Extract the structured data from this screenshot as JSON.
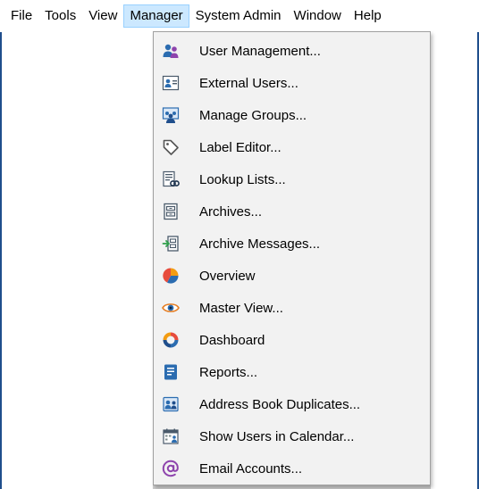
{
  "menubar": {
    "items": [
      {
        "label": "File"
      },
      {
        "label": "Tools"
      },
      {
        "label": "View"
      },
      {
        "label": "Manager"
      },
      {
        "label": "System Admin"
      },
      {
        "label": "Window"
      },
      {
        "label": "Help"
      }
    ],
    "active": "Manager"
  },
  "manager_menu": {
    "items": [
      {
        "label": "User Management...",
        "icon": "user-management-icon"
      },
      {
        "label": "External Users...",
        "icon": "external-users-icon"
      },
      {
        "label": "Manage Groups...",
        "icon": "manage-groups-icon"
      },
      {
        "label": "Label Editor...",
        "icon": "label-tag-icon"
      },
      {
        "label": "Lookup Lists...",
        "icon": "lookup-lists-icon"
      },
      {
        "label": "Archives...",
        "icon": "archives-icon"
      },
      {
        "label": "Archive Messages...",
        "icon": "archive-messages-icon"
      },
      {
        "label": "Overview",
        "icon": "pie-chart-icon"
      },
      {
        "label": "Master View...",
        "icon": "eye-icon"
      },
      {
        "label": "Dashboard",
        "icon": "donut-chart-icon"
      },
      {
        "label": "Reports...",
        "icon": "reports-icon"
      },
      {
        "label": "Address Book Duplicates...",
        "icon": "address-book-duplicates-icon"
      },
      {
        "label": "Show Users in Calendar...",
        "icon": "calendar-users-icon"
      },
      {
        "label": "Email Accounts...",
        "icon": "at-sign-icon"
      }
    ]
  },
  "colors": {
    "menu_background": "#f2f2f2",
    "active_menu_highlight": "#cce8ff",
    "active_menu_border": "#99d1ff",
    "icon_blue": "#2b6cb0",
    "icon_purple": "#8e44ad"
  }
}
